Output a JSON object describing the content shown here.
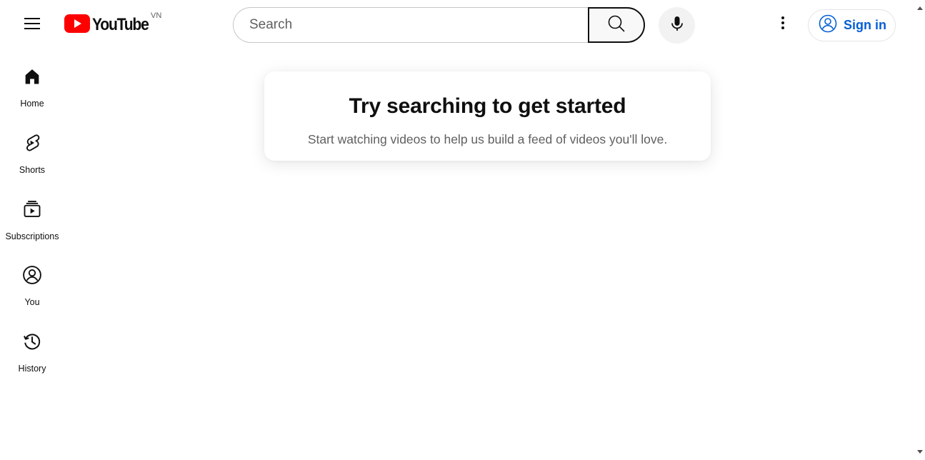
{
  "header": {
    "logo_text": "YouTube",
    "country_code": "VN",
    "brand_red": "#ff0000",
    "search_placeholder": "Search",
    "search_value": "",
    "signin_label": "Sign in",
    "accent_blue": "#065fd4",
    "icons": {
      "menu": "hamburger-menu-icon",
      "search": "search-icon",
      "mic": "microphone-icon",
      "more": "more-vertical-icon",
      "account": "account-circle-icon"
    }
  },
  "sidebar": {
    "items": [
      {
        "label": "Home",
        "icon": "home-icon"
      },
      {
        "label": "Shorts",
        "icon": "shorts-icon"
      },
      {
        "label": "Subscriptions",
        "icon": "subscriptions-icon"
      },
      {
        "label": "You",
        "icon": "you-icon"
      },
      {
        "label": "History",
        "icon": "history-icon"
      }
    ]
  },
  "main": {
    "card_title": "Try searching to get started",
    "card_subtitle": "Start watching videos to help us build a feed of videos you'll love."
  }
}
